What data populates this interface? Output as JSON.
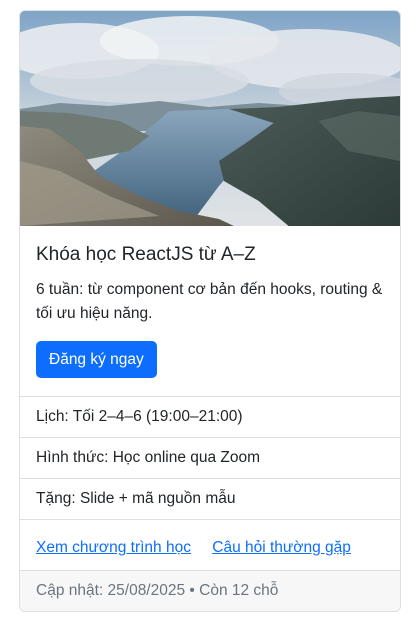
{
  "course": {
    "image_alt": "fjord landscape",
    "title": "Khóa học ReactJS từ A–Z",
    "description": "6 tuần: từ component cơ bản đến hooks, routing & tối ưu hiệu năng.",
    "cta_label": "Đăng ký ngay",
    "details": [
      {
        "text": "Lịch: Tối 2–4–6 (19:00–21:00)"
      },
      {
        "text": "Hình thức: Học online qua Zoom"
      },
      {
        "text": "Tặng: Slide + mã nguồn mẫu"
      }
    ],
    "links": [
      {
        "label": "Xem chương trình học"
      },
      {
        "label": "Câu hỏi thường gặp"
      }
    ],
    "footer": "Cập nhật: 25/08/2025 • Còn 12 chỗ"
  },
  "colors": {
    "primary": "#0d6efd",
    "border": "#dcdfe3",
    "footer_bg": "#f7f7f7",
    "muted": "#6c757d"
  }
}
